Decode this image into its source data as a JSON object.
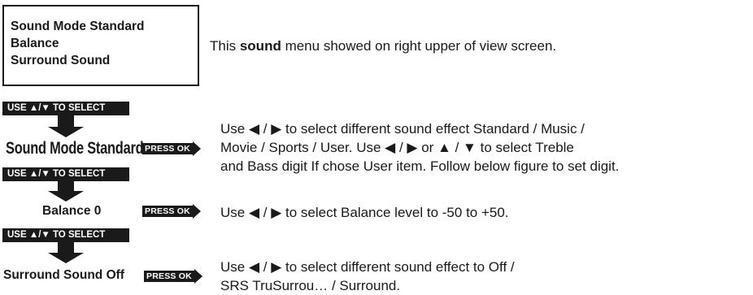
{
  "menu_box": {
    "lines": [
      "Sound Mode Standard",
      "Balance",
      "Surround Sound"
    ]
  },
  "intro": {
    "before": "This ",
    "bold": "sound",
    "after": " menu showed on right upper of view screen."
  },
  "banner_label": "USE ▲/▼ TO SELECT",
  "press_label": "PRESS OK",
  "steps": [
    {
      "label": "Sound Mode Standard",
      "lines": [
        "Use ◀ / ▶ to select different sound effect Standard / Music /",
        "Movie / Sports / User. Use ◀ / ▶ or ▲ / ▼ to select Treble",
        "and Bass digit If chose User item. Follow below figure to set digit."
      ]
    },
    {
      "label": "Balance 0",
      "lines": [
        "Use ◀ / ▶ to select Balance level to -50 to +50."
      ]
    },
    {
      "label": "Surround Sound Off",
      "lines": [
        "Use ◀ / ▶ to select different sound effect to Off /",
        "SRS TruSurrou… / Surround."
      ]
    }
  ],
  "icons": [
    "arrow-down-icon",
    "press-ok-arrow-icon"
  ]
}
